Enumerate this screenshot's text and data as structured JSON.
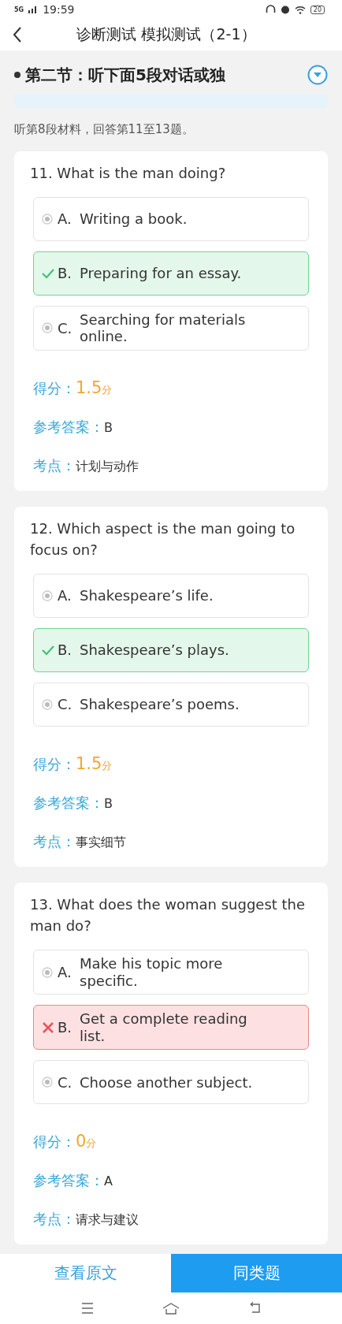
{
  "status_bar": {
    "network": "5G",
    "time": "19:59",
    "battery": "20"
  },
  "header": {
    "title": "诊断测试 模拟测试（2-1）"
  },
  "section": {
    "title": "第二节：听下面5段对话或独",
    "expanded": false
  },
  "instruction": "听第8段材料，回答第11至13题。",
  "questions": [
    {
      "question": "11. What is the man doing?",
      "options": [
        {
          "letter": "A.",
          "text": "Writing a book.",
          "kind": "normal"
        },
        {
          "letter": "B.",
          "text": "Preparing for an essay.",
          "kind": "correct"
        },
        {
          "letter": "C.",
          "text": "Searching for materials online.",
          "kind": "normal"
        }
      ],
      "score_label": "得分：",
      "score": "1.5",
      "score_unit": "分",
      "answer_label": "参考答案：",
      "answer": "B",
      "point_label": "考点：",
      "point": "计划与动作"
    },
    {
      "question": "12. Which aspect is the man going to focus on?",
      "options": [
        {
          "letter": "A.",
          "text": "Shakespeare’s life.",
          "kind": "normal"
        },
        {
          "letter": "B.",
          "text": "Shakespeare’s plays.",
          "kind": "correct"
        },
        {
          "letter": "C.",
          "text": "Shakespeare’s poems.",
          "kind": "normal"
        }
      ],
      "score_label": "得分：",
      "score": "1.5",
      "score_unit": "分",
      "answer_label": "参考答案：",
      "answer": "B",
      "point_label": "考点：",
      "point": "事实细节"
    },
    {
      "question": "13. What does the woman suggest the man do?",
      "options": [
        {
          "letter": "A.",
          "text": "Make his topic more specific.",
          "kind": "normal"
        },
        {
          "letter": "B.",
          "text": "Get a complete reading list.",
          "kind": "wrong"
        },
        {
          "letter": "C.",
          "text": "Choose another subject.",
          "kind": "normal"
        }
      ],
      "score_label": "得分：",
      "score": "0",
      "score_unit": "分",
      "answer_label": "参考答案：",
      "answer": "A",
      "point_label": "考点：",
      "point": "请求与建议"
    }
  ],
  "bottom_buttons": [
    {
      "label": "查看原文",
      "primary": false
    },
    {
      "label": "同类题",
      "primary": true
    }
  ]
}
